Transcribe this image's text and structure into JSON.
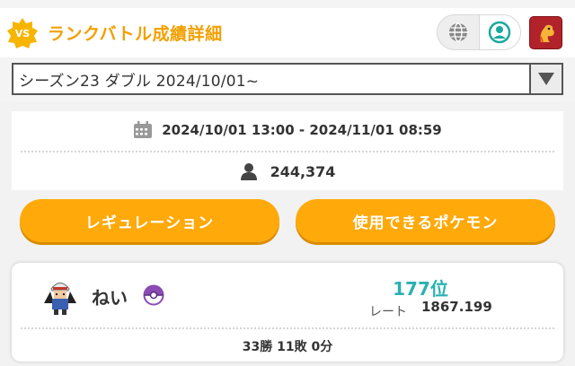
{
  "header": {
    "badge_text": "VS",
    "title": "ランクバトル成績詳細",
    "icons": [
      "globe-icon",
      "user-circle-icon",
      "game-logo-icon"
    ]
  },
  "season_select": {
    "selected": "シーズン23 ダブル 2024/10/01~",
    "arrow_icon": "triangle-down-icon"
  },
  "period": {
    "icon": "calendar-icon",
    "text": "2024/10/01 13:00 - 2024/11/01 08:59"
  },
  "participants": {
    "icon": "person-icon",
    "count": "244,374"
  },
  "buttons": {
    "regulation": "レギュレーション",
    "usable_pokemon": "使用できるポケモン"
  },
  "player": {
    "name": "ねい",
    "ball_icon": "ball-icon",
    "rank": "177位",
    "rate_label": "レート",
    "rate": "1867.199",
    "record": "33勝 11敗 0分"
  },
  "colors": {
    "accent": "#ffa90b",
    "title": "#f2a000",
    "rank": "#2bb1b1"
  }
}
